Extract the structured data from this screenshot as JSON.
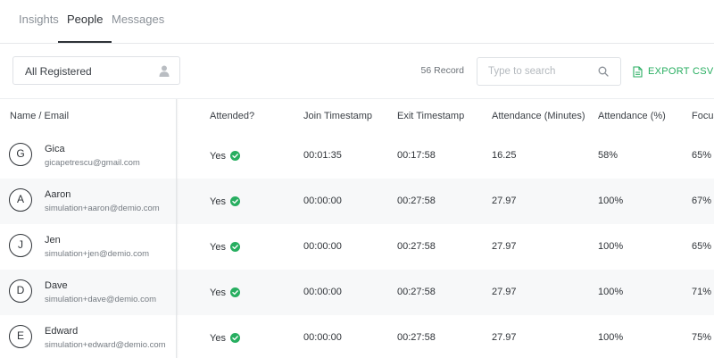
{
  "tabs": [
    {
      "label": "Insights",
      "active": false
    },
    {
      "label": "People",
      "active": true
    },
    {
      "label": "Messages",
      "active": false
    }
  ],
  "toolbar": {
    "filter_value": "All Registered",
    "record_count": "56 Record",
    "search_placeholder": "Type to search",
    "export_label": "EXPORT CSV",
    "accent_color": "#27ae60"
  },
  "table": {
    "headers": {
      "name": "Name / Email",
      "attended": "Attended?",
      "join": "Join Timestamp",
      "exit": "Exit Timestamp",
      "minutes": "Attendance (Minutes)",
      "percent": "Attendance (%)",
      "focus": "Focus"
    },
    "rows": [
      {
        "initial": "G",
        "name": "Gica",
        "email": "gicapetrescu@gmail.com",
        "attended": "Yes",
        "join": "00:01:35",
        "exit": "00:17:58",
        "minutes": "16.25",
        "percent": "58%",
        "focus": "65%"
      },
      {
        "initial": "A",
        "name": "Aaron",
        "email": "simulation+aaron@demio.com",
        "attended": "Yes",
        "join": "00:00:00",
        "exit": "00:27:58",
        "minutes": "27.97",
        "percent": "100%",
        "focus": "67%"
      },
      {
        "initial": "J",
        "name": "Jen",
        "email": "simulation+jen@demio.com",
        "attended": "Yes",
        "join": "00:00:00",
        "exit": "00:27:58",
        "minutes": "27.97",
        "percent": "100%",
        "focus": "65%"
      },
      {
        "initial": "D",
        "name": "Dave",
        "email": "simulation+dave@demio.com",
        "attended": "Yes",
        "join": "00:00:00",
        "exit": "00:27:58",
        "minutes": "27.97",
        "percent": "100%",
        "focus": "71%"
      },
      {
        "initial": "E",
        "name": "Edward",
        "email": "simulation+edward@demio.com",
        "attended": "Yes",
        "join": "00:00:00",
        "exit": "00:27:58",
        "minutes": "27.97",
        "percent": "100%",
        "focus": "75%"
      }
    ]
  }
}
